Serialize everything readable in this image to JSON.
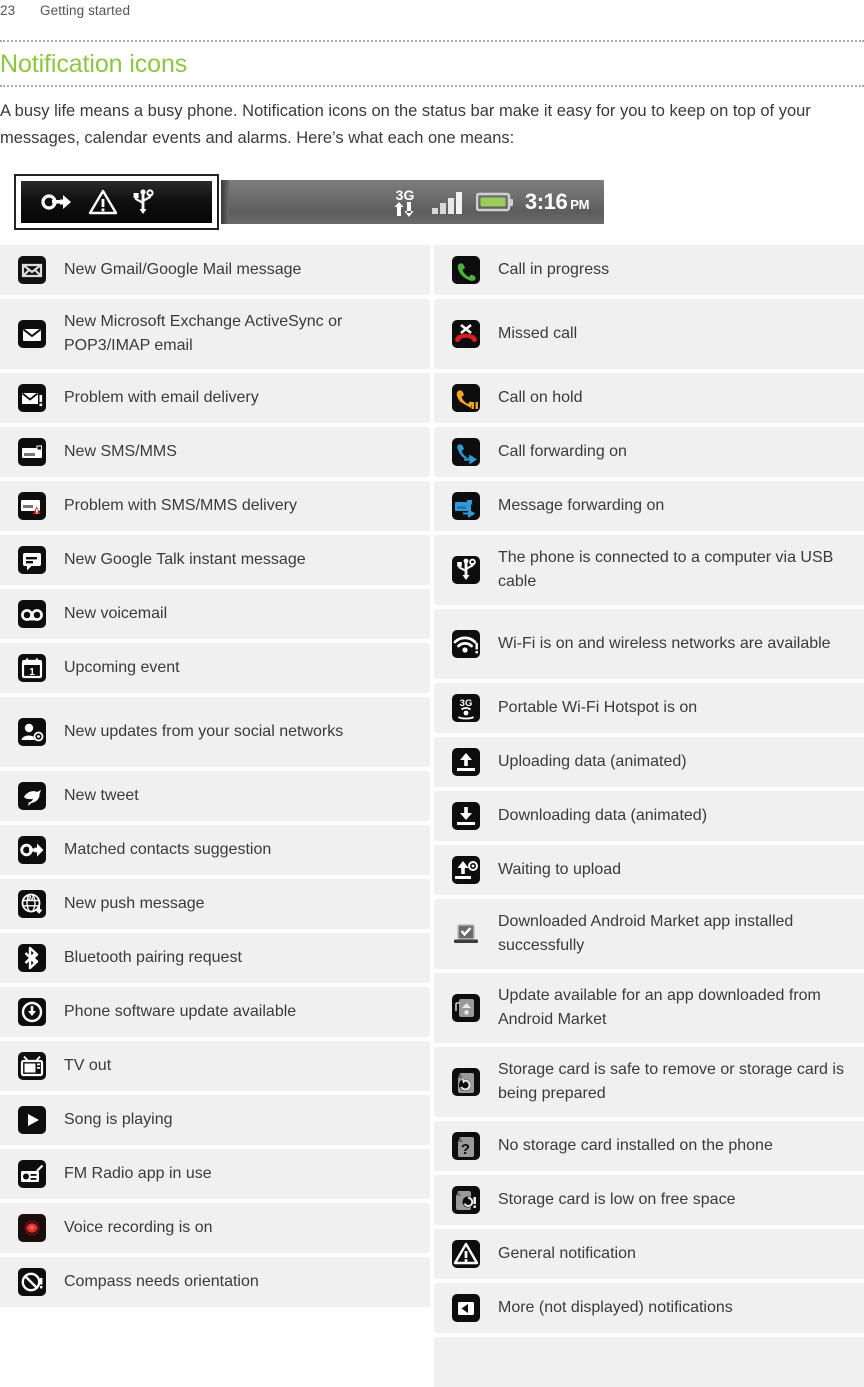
{
  "header": {
    "page_number": "23",
    "section": "Getting started"
  },
  "section": {
    "title": "Notification icons",
    "intro": "A busy life means a busy phone. Notification icons on the status bar make it easy for you to keep on top of your messages, calendar events and alarms. Here’s what each one means:"
  },
  "statusbar": {
    "notification_icons": [
      "matched-contacts-icon",
      "general-notification-icon",
      "usb-icon"
    ],
    "status_icons": [
      "3g-data-icon",
      "signal-strength-icon",
      "battery-icon"
    ],
    "time": "3:16",
    "ampm": "PM",
    "battery_color": "#9ACD5A",
    "bar_color": "#6d6d6d"
  },
  "table": {
    "left_column": [
      {
        "icon": "gmail-icon",
        "label": "New Gmail/Google Mail message",
        "lines": 1
      },
      {
        "icon": "email-icon",
        "label": "New Microsoft Exchange ActiveSync or POP3/IMAP email",
        "lines": 2
      },
      {
        "icon": "email-problem-icon",
        "label": "Problem with email delivery",
        "lines": 1
      },
      {
        "icon": "sms-icon",
        "label": "New SMS/MMS",
        "lines": 1
      },
      {
        "icon": "sms-problem-icon",
        "label": "Problem with SMS/MMS delivery",
        "lines": 1
      },
      {
        "icon": "google-talk-icon",
        "label": "New Google Talk instant message",
        "lines": 1
      },
      {
        "icon": "voicemail-icon",
        "label": "New voicemail",
        "lines": 1
      },
      {
        "icon": "calendar-event-icon",
        "label": "Upcoming event",
        "lines": 1
      },
      {
        "icon": "social-updates-icon",
        "label": "New updates from your social networks",
        "lines": 2
      },
      {
        "icon": "twitter-icon",
        "label": "New tweet",
        "lines": 1
      },
      {
        "icon": "matched-contacts-icon",
        "label": "Matched contacts suggestion",
        "lines": 1
      },
      {
        "icon": "push-message-icon",
        "label": "New push message",
        "lines": 1
      },
      {
        "icon": "bluetooth-icon",
        "label": "Bluetooth pairing request",
        "lines": 1
      },
      {
        "icon": "software-update-icon",
        "label": "Phone software update available",
        "lines": 1
      },
      {
        "icon": "tv-out-icon",
        "label": "TV out",
        "lines": 1
      },
      {
        "icon": "music-play-icon",
        "label": "Song is playing",
        "lines": 1
      },
      {
        "icon": "fm-radio-icon",
        "label": "FM Radio app in use",
        "lines": 1
      },
      {
        "icon": "voice-recording-icon",
        "label": "Voice recording is on",
        "lines": 1
      },
      {
        "icon": "compass-icon",
        "label": "Compass needs orientation",
        "lines": 1
      }
    ],
    "right_column": [
      {
        "icon": "call-in-progress-icon",
        "label": "Call in progress",
        "lines": 1
      },
      {
        "icon": "missed-call-icon",
        "label": "Missed call",
        "lines": 2
      },
      {
        "icon": "call-on-hold-icon",
        "label": "Call on hold",
        "lines": 1
      },
      {
        "icon": "call-forwarding-icon",
        "label": "Call forwarding on",
        "lines": 1
      },
      {
        "icon": "message-forwarding-icon",
        "label": "Message forwarding on",
        "lines": 1
      },
      {
        "icon": "usb-icon",
        "label": "The phone is connected to a computer via USB cable",
        "lines": 2
      },
      {
        "icon": "wifi-available-icon",
        "label": "Wi-Fi is on and wireless networks are available",
        "lines": 2
      },
      {
        "icon": "wifi-hotspot-icon",
        "label": "Portable Wi-Fi Hotspot is on",
        "lines": 1
      },
      {
        "icon": "upload-icon",
        "label": "Uploading data (animated)",
        "lines": 1
      },
      {
        "icon": "download-icon",
        "label": "Downloading data (animated)",
        "lines": 1
      },
      {
        "icon": "waiting-upload-icon",
        "label": "Waiting to upload",
        "lines": 1
      },
      {
        "icon": "app-installed-icon",
        "label": "Downloaded Android Market app installed successfully",
        "lines": 2
      },
      {
        "icon": "app-update-icon",
        "label": "Update available for an app downloaded from Android Market",
        "lines": 2
      },
      {
        "icon": "storage-safe-remove-icon",
        "label": "Storage card is safe to remove or storage card is being prepared",
        "lines": 2
      },
      {
        "icon": "no-storage-card-icon",
        "label": "No storage card installed on the phone",
        "lines": 1
      },
      {
        "icon": "storage-low-icon",
        "label": "Storage card is low on free space",
        "lines": 1
      },
      {
        "icon": "general-notification-icon",
        "label": "General notification",
        "lines": 1
      },
      {
        "icon": "more-notifications-icon",
        "label": "More (not displayed) notifications",
        "lines": 1
      }
    ]
  }
}
